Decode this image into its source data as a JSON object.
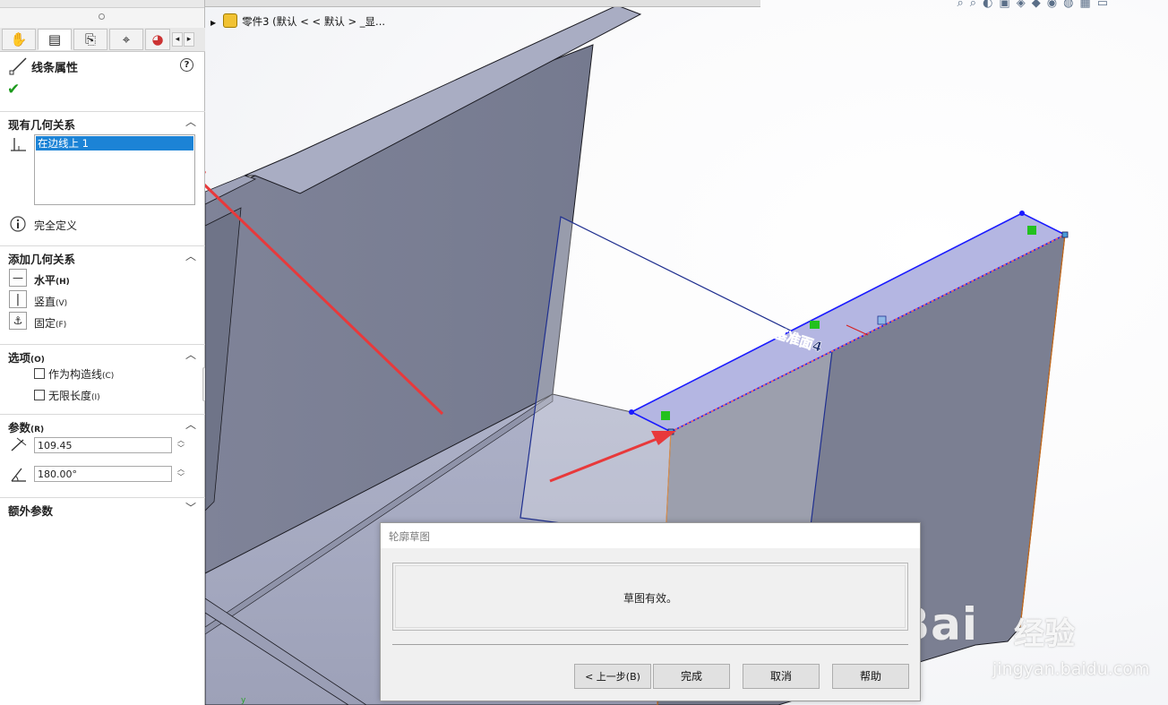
{
  "property_manager": {
    "title": "线条属性",
    "help_glyph": "?",
    "ok_glyph": "✔",
    "sections": {
      "existing_relations": {
        "label": "现有几何关系",
        "items": [
          "在边线上 1"
        ],
        "status": "完全定义"
      },
      "add_relations": {
        "label": "添加几何关系",
        "items": [
          {
            "label": "水平",
            "shortcut": "(H)"
          },
          {
            "label": "竖直",
            "shortcut": "(V)"
          },
          {
            "label": "固定",
            "shortcut": "(F)"
          }
        ]
      },
      "options": {
        "label": "选项",
        "shortcut": "(O)",
        "items": [
          {
            "label": "作为构造线",
            "shortcut": "(C)",
            "checked": false
          },
          {
            "label": "无限长度",
            "shortcut": "(I)",
            "checked": false
          }
        ]
      },
      "parameters": {
        "label": "参数",
        "shortcut": "(R)",
        "length": "109.45",
        "angle": "180.00°"
      },
      "extra_parameters": {
        "label": "额外参数"
      }
    }
  },
  "viewport": {
    "breadcrumb": "零件3  (默认 < < 默认 > _显...",
    "plane_label": "基准面4",
    "axis_glyph": "y"
  },
  "dialog": {
    "title": "轮廓草图",
    "message": "草图有效。",
    "buttons": {
      "back": "< 上一步(B)",
      "finish": "完成",
      "cancel": "取消",
      "help": "帮助"
    }
  },
  "watermark": {
    "brand": "Bai",
    "suffix": "经验",
    "url": "jingyan.baidu.com"
  },
  "colors": {
    "selection_blue": "#1c83d6",
    "sketch_line": "#1a1aff",
    "face_gray": "#7b7f92",
    "annotation_red": "#e8393b",
    "relation_green": "#22c11e"
  }
}
